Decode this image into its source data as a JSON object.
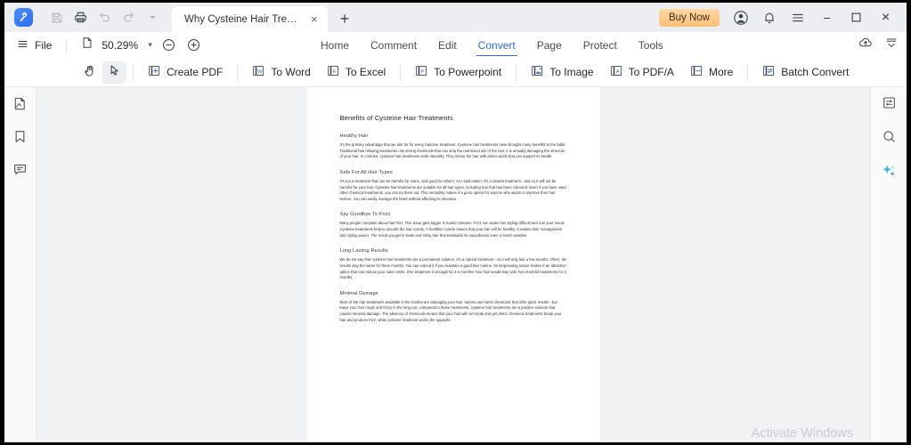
{
  "titlebar": {
    "logo_icon": "app-logo-icon",
    "quick_actions": [
      {
        "name": "save-icon",
        "label": "Save",
        "disabled": true
      },
      {
        "name": "print-icon",
        "label": "Print",
        "disabled": false
      },
      {
        "name": "undo-icon",
        "label": "Undo",
        "disabled": true
      },
      {
        "name": "redo-icon",
        "label": "Redo",
        "disabled": true
      },
      {
        "name": "quick-access-caret-icon",
        "label": "More",
        "disabled": true
      }
    ],
    "tab": {
      "title": "Why Cysteine Hair Treat...",
      "close_label": "×"
    },
    "new_tab_label": "+",
    "buy_now_label": "Buy Now",
    "account_icon": "account-icon",
    "notification_icon": "bell-icon",
    "menu_icon": "hamburger-menu-icon",
    "window_controls": {
      "minimize": "−",
      "maximize": "□",
      "close": "×"
    }
  },
  "menubar": {
    "file_label": "File",
    "file_icon": "hamburger-icon",
    "page_icon": "page-fit-icon",
    "zoom_value": "50.29%",
    "zoom_caret": "▾",
    "zoom_out_icon": "zoom-out-icon",
    "zoom_in_icon": "zoom-in-icon",
    "tabs": [
      {
        "label": "Home",
        "active": false
      },
      {
        "label": "Comment",
        "active": false
      },
      {
        "label": "Edit",
        "active": false
      },
      {
        "label": "Convert",
        "active": true
      },
      {
        "label": "Page",
        "active": false
      },
      {
        "label": "Protect",
        "active": false
      },
      {
        "label": "Tools",
        "active": false
      }
    ],
    "cloud_upload_icon": "cloud-upload-icon",
    "collapse_ribbon_icon": "collapse-ribbon-icon"
  },
  "toolbar": {
    "hand_tool": {
      "label": "Hand Tool",
      "icon": "hand-icon",
      "selected": false
    },
    "select_tool": {
      "label": "Select Tool",
      "icon": "cursor-arrow-icon",
      "selected": true
    },
    "items": [
      {
        "label": "Create PDF",
        "icon": "create-pdf-icon",
        "glyph": "+"
      },
      {
        "label": "To Word",
        "icon": "to-word-icon",
        "glyph": "W"
      },
      {
        "label": "To Excel",
        "icon": "to-excel-icon",
        "glyph": "E"
      },
      {
        "label": "To Powerpoint",
        "icon": "to-powerpoint-icon",
        "glyph": "P"
      },
      {
        "label": "To Image",
        "icon": "to-image-icon",
        "glyph": "◤"
      },
      {
        "label": "To PDF/A",
        "icon": "to-pdfa-icon",
        "glyph": "A"
      },
      {
        "label": "More",
        "icon": "more-icon",
        "glyph": "⋯"
      },
      {
        "label": "Batch Convert",
        "icon": "batch-convert-icon",
        "glyph": "⇄"
      }
    ]
  },
  "left_rail": [
    {
      "name": "thumbnails-icon",
      "label": "Thumbnails"
    },
    {
      "name": "bookmark-icon",
      "label": "Bookmarks"
    },
    {
      "name": "comment-icon",
      "label": "Comments"
    }
  ],
  "right_rail": [
    {
      "name": "properties-panel-icon",
      "label": "Properties"
    },
    {
      "name": "search-icon",
      "label": "Search"
    },
    {
      "name": "ai-sparkle-icon",
      "label": "AI Assistant"
    }
  ],
  "document": {
    "title": "Benefits of Cysteine Hair Treatments",
    "sections": [
      {
        "heading": "Healthy Hair",
        "body": "It's the primary advantage that we aim for for every haircare treatment. Cysteine hair treatments have brought many benefits to the table. Traditional hair relaxing treatments use strong chemicals that can strip the nutritional oils of the hair. It is actually damaging the structure of your hair. In contrast, cysteine hair treatments work naturally. They infuse the hair with amino acids that can support its health."
      },
      {
        "heading": "Safe For All Hair Types",
        "body": "It's not a treatment that can be harmful for some, and good for others. As I said earlier, it's a natural treatment - and so it will not be harmful for your hair. Cysteine hair treatments are suitable for all hair types, including hair that has been coloured. Even if you have used other chemical treatments, you can try them out. This versatility makes it a go-to option for anyone who wants to improve their hair texture. You can easily manage the heart without affecting its structure."
      },
      {
        "heading": "Say Goodbye To Frizz",
        "body": "Many people complain about hair frizz. This issue gets bigger in humid climates. Frizz can make hair styling difficult and ruin your mood. Cysteine treatments help to smooth the hair cuticle. A healthier cuticle means that your hair will be healthy. It makes their management and styling easier. The result you get is sleek and shiny hair that maintains its smoothness even in harsh weather."
      },
      {
        "heading": "Long Lasting Results",
        "body": "We do not say that cysteine hair treatments are a permanent solution. It's a natural treatment - so it will only last a few months. Often, the results stay the same for three months. You can extend it if you maintain a good hair routine. Its long-lasting nature makes it an attractive option that can reduce your salon visits. One treatment is enough for 3-4 months! Your hair would stay safe from harmful treatments for 3 months."
      },
      {
        "heading": "Minimal Damage",
        "body": "Most of the hair treatments available in the market are damaging your hair. Salons use harsh chemicals that offer quick results - but leave your hair rough and frizzy in the long run; compared to these treatments, cysteine hair treatments are a positive solution that causes minimal damage. The absence of chemicals means that your hair will not break and get dried. Chemical treatments break your hair and produce frizz, while cysteine treatment works the opposite."
      }
    ]
  },
  "watermark": "Activate Windows",
  "colors": {
    "accent": "#2f6ae2",
    "titlebar_bg": "#eceef1",
    "buy_now_bg": "#fdbf77",
    "doc_bg": "#f1f2f4",
    "rail_bg": "#fafafa"
  }
}
